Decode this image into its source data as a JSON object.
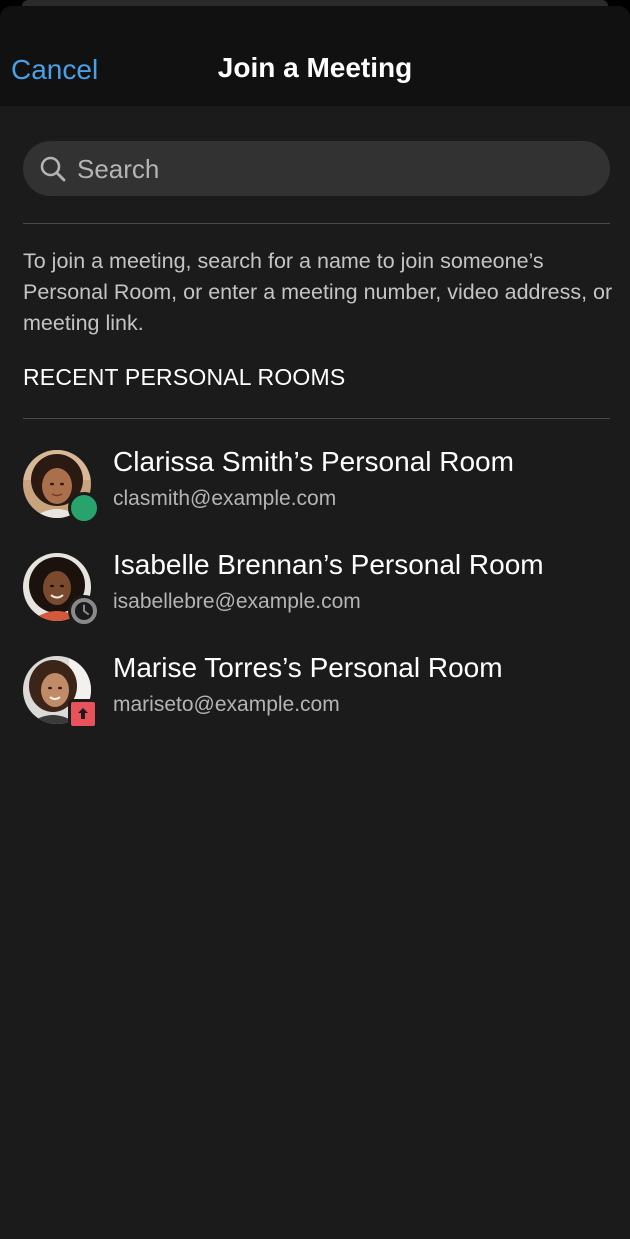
{
  "navbar": {
    "cancel_label": "Cancel",
    "title": "Join a Meeting"
  },
  "search": {
    "placeholder": "Search",
    "value": ""
  },
  "help_text": "To join a meeting, search for a name to join someone’s Personal Room, or enter a meeting number, video address, or meeting link.",
  "section": {
    "title": "RECENT PERSONAL ROOMS"
  },
  "rooms": [
    {
      "name": "Clarissa Smith’s Personal Room",
      "email": "clasmith@example.com",
      "status": "available",
      "status_icon": "available-dot-icon",
      "status_color": "#27a36b"
    },
    {
      "name": "Isabelle Brennan’s Personal Room",
      "email": "isabellebre@example.com",
      "status": "away",
      "status_icon": "clock-icon",
      "status_color": "#8a8a8a"
    },
    {
      "name": "Marise Torres’s Personal Room",
      "email": "mariseto@example.com",
      "status": "presenting",
      "status_icon": "share-screen-icon",
      "status_color": "#e8525b"
    }
  ],
  "colors": {
    "accent": "#4a9fe6",
    "background": "#1b1b1b",
    "navbar": "#111111",
    "search_field": "#323232"
  }
}
